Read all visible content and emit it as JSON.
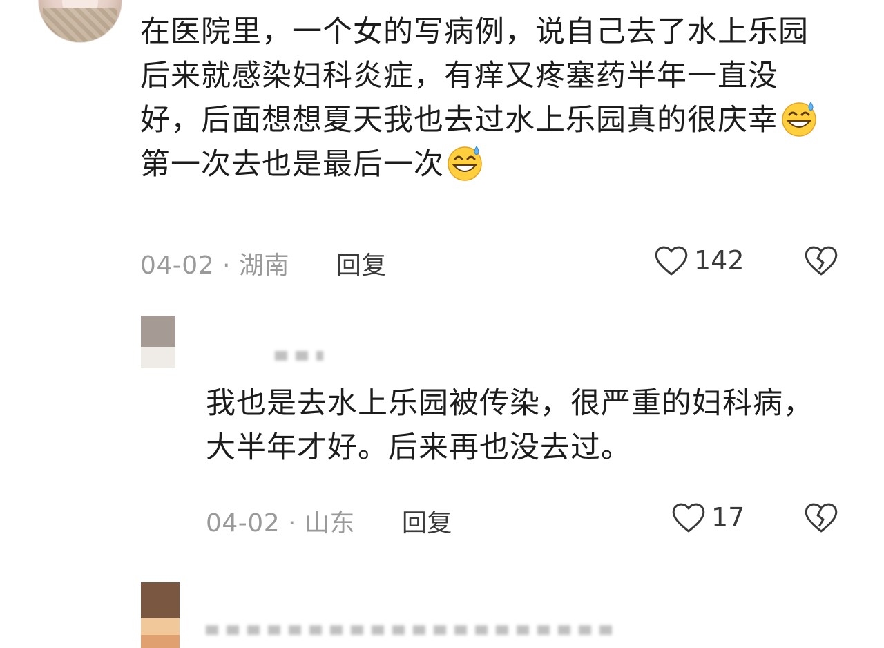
{
  "comments": [
    {
      "text_parts": [
        "在医院里，一个女的写病例，说自己去了水上乐园后来就感染妇科炎症，有痒又疼塞药半年一直没好，后面想想夏天我也去过水上乐园真的很庆幸",
        "第一次去也是最后一次"
      ],
      "emoji": "grinning-sweat-emoji",
      "date": "04-02",
      "location": "湖南",
      "reply_label": "回复",
      "likes": "142"
    },
    {
      "text": "我也是去水上乐园被传染，很严重的妇科病，大半年才好。后来再也没去过。",
      "date": "04-02",
      "location": "山东",
      "reply_label": "回复",
      "likes": "17"
    }
  ],
  "separator": " · ",
  "icons": {
    "like": "heart-outline-icon",
    "dislike": "broken-heart-icon"
  },
  "colors": {
    "text": "#1c1c1c",
    "meta": "#9a9a9a",
    "icon": "#3a3a3a"
  }
}
